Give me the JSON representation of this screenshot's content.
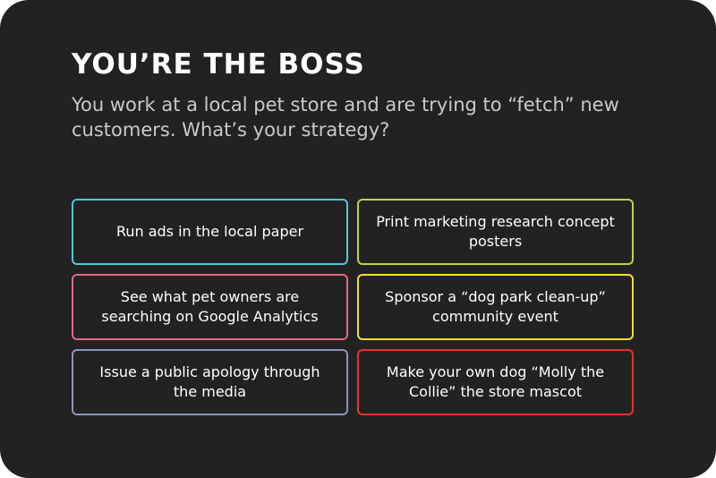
{
  "card": {
    "title": "YOU’RE THE BOSS",
    "question": "You work at a local pet store and are trying to “fetch” new customers. What’s your strategy?"
  },
  "options": [
    {
      "label": "Run ads in the local paper",
      "border_color": "#4ec9d6"
    },
    {
      "label": "Print marketing research concept posters",
      "border_color": "#c4cf48"
    },
    {
      "label": "See what pet owners are searching on Google Analytics",
      "border_color": "#e06b82"
    },
    {
      "label": "Sponsor a “dog park clean-up” community event",
      "border_color": "#f2e02a"
    },
    {
      "label": "Issue a public apology through the media",
      "border_color": "#8e94bd"
    },
    {
      "label": "Make your own dog “Molly the Collie” the store mascot",
      "border_color": "#e8322a"
    }
  ],
  "colors": {
    "card_background": "#222222",
    "title": "#ffffff",
    "question": "#c9c9c9",
    "option_text": "#ffffff"
  }
}
